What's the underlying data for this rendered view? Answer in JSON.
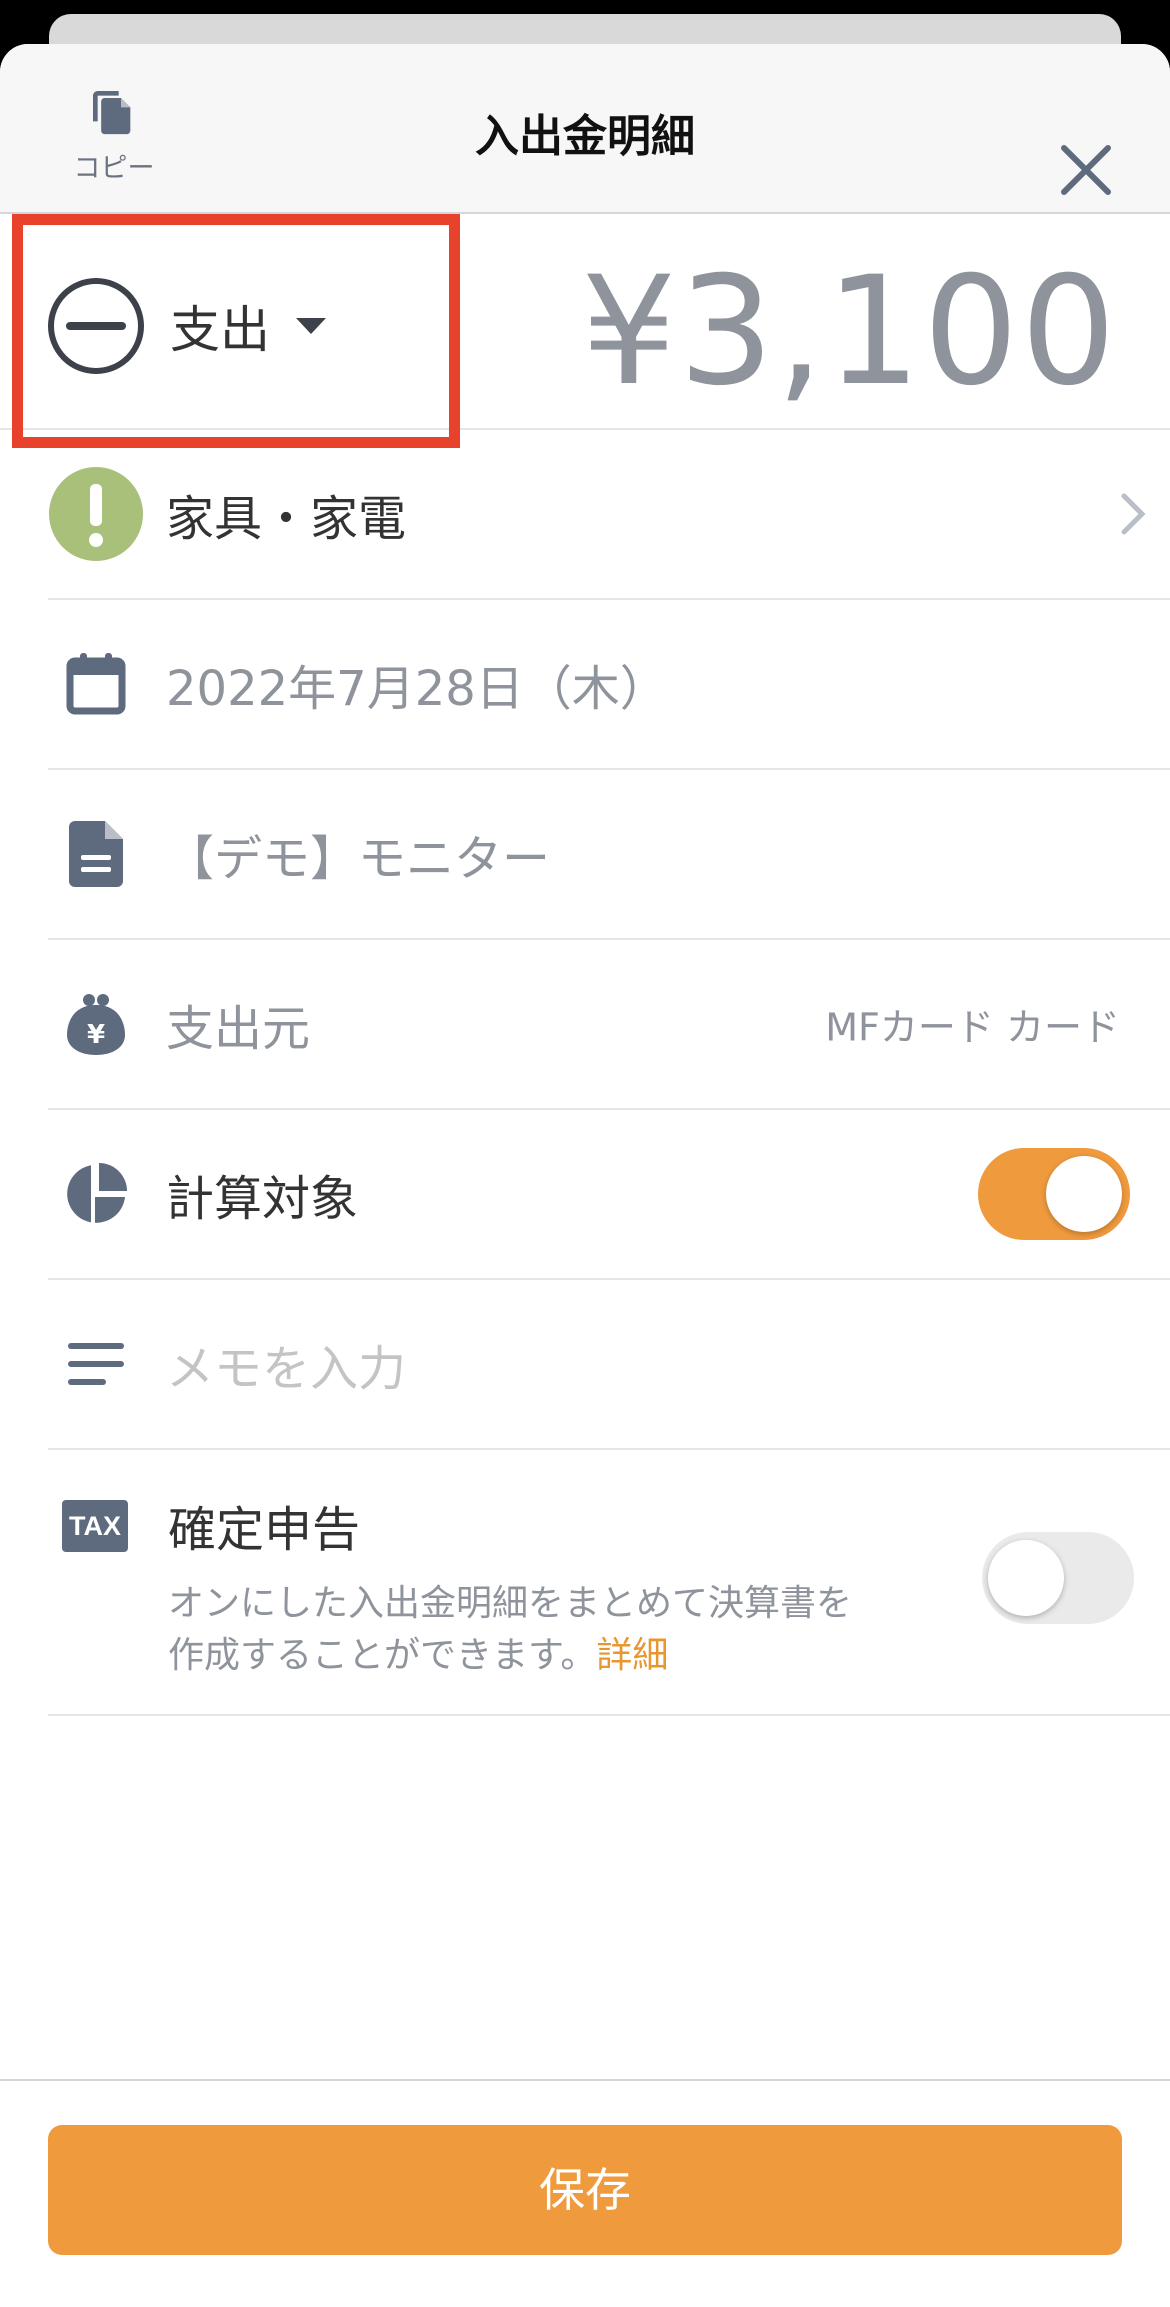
{
  "header": {
    "copy_label": "コピー",
    "title": "入出金明細"
  },
  "transaction": {
    "type_label": "支出",
    "amount": "¥3,100"
  },
  "fields": {
    "category": "家具・家電",
    "date": "2022年7月28日（木）",
    "content": "【デモ】モニター",
    "source_label": "支出元",
    "source_value": "MFカード カード",
    "calc_target_label": "計算対象",
    "calc_target_on": true,
    "memo_placeholder": "メモを入力",
    "tax": {
      "badge": "TAX",
      "title": "確定申告",
      "desc_line1": "オンにした入出金明細をまとめて決算書を",
      "desc_line2": "作成することができます。",
      "link": "詳細",
      "on": false
    }
  },
  "footer": {
    "save_label": "保存"
  },
  "colors": {
    "accent": "#f09a3e",
    "highlight_box": "#e8412c",
    "category_icon": "#a8c07a",
    "icon_gray": "#5e6a7d"
  },
  "icons": {
    "copy": "copy-icon",
    "close": "close-icon",
    "expense_type": "minus-circle-icon",
    "caret": "caret-down-icon",
    "category": "exclamation-circle-icon",
    "date": "calendar-icon",
    "content": "document-icon",
    "source": "wallet-yen-icon",
    "calc_target": "pie-chart-icon",
    "memo": "menu-lines-icon",
    "tax": "tax-badge-icon"
  }
}
